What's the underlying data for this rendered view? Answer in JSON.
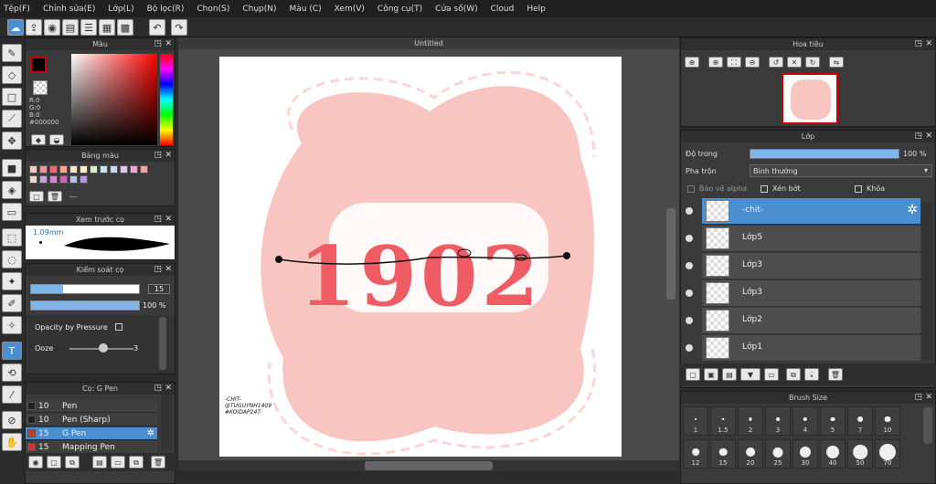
{
  "menu": [
    "Tệp(F)",
    "Chỉnh sửa(E)",
    "Lớp(L)",
    "Bộ lọc(R)",
    "Chọn(S)",
    "Chụp(N)",
    "Màu (C)",
    "Xem(V)",
    "Công cụ(T)",
    "Cửa số(W)",
    "Cloud",
    "Help"
  ],
  "document": {
    "title": "Untitled"
  },
  "color_panel": {
    "title": "Màu",
    "r": "R:0",
    "g": "G:0",
    "b": "B:0",
    "hex": "#000000",
    "fg": "#000000",
    "bg": "#ffffff"
  },
  "palette": {
    "title": "Bảng màu",
    "colors": [
      "#f4c7c3",
      "#e6999d",
      "#f06a6a",
      "#f9a58c",
      "#fce4c4",
      "#f9f0c8",
      "#d5f2c9",
      "#bfe8e9",
      "#c9d8f4",
      "#e4c4f1",
      "#f4a3d3",
      "#f1a3a3",
      "#f7d3c8",
      "#c7a3e3",
      "#e07de0",
      "#d860c0",
      "#b0c4ef",
      "#b895e0"
    ],
    "footer": "---"
  },
  "preview": {
    "title": "Xem trước cọ",
    "size": "1.09mm"
  },
  "brush_control": {
    "title": "Kiểm soát cọ",
    "size_value": "15",
    "opacity_value": "100 %",
    "opacity_by_pressure": "Opacity by Pressure",
    "ooze_label": "Ooze",
    "ooze_value": "3"
  },
  "brushes": {
    "title": "Cọ: G Pen",
    "items": [
      {
        "size": "10",
        "name": "Pen",
        "color": "#222222"
      },
      {
        "size": "10",
        "name": "Pen (Sharp)",
        "color": "#222222"
      },
      {
        "size": "15",
        "name": "G Pen",
        "color": "#d33333",
        "selected": true
      },
      {
        "size": "15",
        "name": "Mapping Pen",
        "color": "#d33333"
      }
    ]
  },
  "navigator": {
    "title": "Hoa tiêu"
  },
  "layers": {
    "title": "Lớp",
    "opacity_label": "Độ trong",
    "opacity_value": "100 %",
    "opacity_fraction": 1.0,
    "blend_label": "Pha trộn",
    "blend_value": "Bình thường",
    "protect_alpha": "Bảo vệ alpha",
    "clipping": "Xén bớt",
    "lock": "Khóa",
    "items": [
      {
        "name": "-chit-",
        "selected": true
      },
      {
        "name": "Lớp5"
      },
      {
        "name": "Lớp3"
      },
      {
        "name": "Lớp3"
      },
      {
        "name": "Lớp2"
      },
      {
        "name": "Lớp1"
      }
    ]
  },
  "brush_size": {
    "title": "Brush Size",
    "row1": [
      "1",
      "1.5",
      "2",
      "3",
      "4",
      "5",
      "7",
      "10"
    ],
    "row2": [
      "12",
      "15",
      "20",
      "25",
      "30",
      "40",
      "50",
      "70"
    ]
  },
  "artwork": {
    "main_text": "1902",
    "credit_lines": [
      "-CHIT-",
      "@TUGUYNH1409",
      "#KOIDAP247"
    ]
  }
}
